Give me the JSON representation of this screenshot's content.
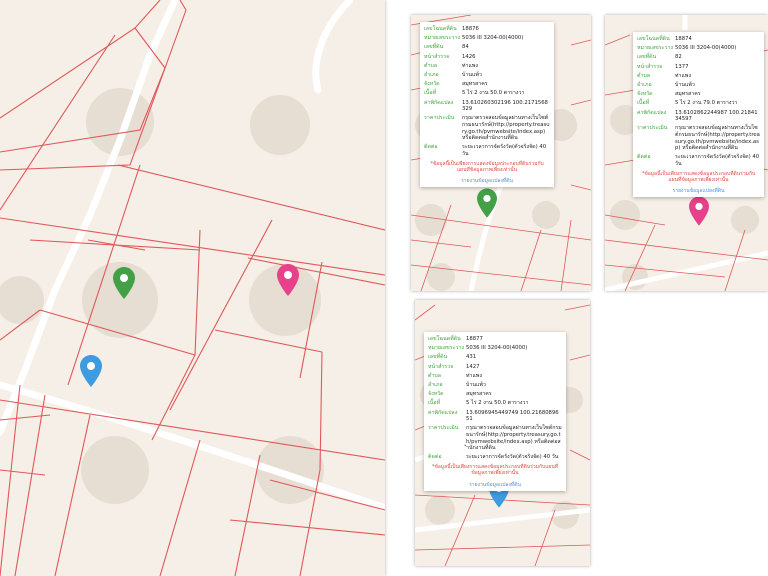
{
  "colors": {
    "map_bg": "#f6efe7",
    "parcel_line": "#e0585a",
    "road": "#ffffff",
    "pin_green": "#43a047",
    "pin_pink": "#e6418a",
    "pin_blue": "#3d9be0",
    "label_green": "#3ca53c",
    "note_red": "#e0473f",
    "link_blue": "#4a90d9"
  },
  "pins": [
    {
      "name": "green-pin",
      "color": "green"
    },
    {
      "name": "pink-pin",
      "color": "pink"
    },
    {
      "name": "blue-pin",
      "color": "blue"
    }
  ],
  "cards": [
    {
      "pin": "green",
      "rows": [
        {
          "label": "เลขโฉนดที่ดิน",
          "value": "18876"
        },
        {
          "label": "หมายเลขระวาง",
          "value": "5036 III 3204-00(4000)"
        },
        {
          "label": "เลขที่ดิน",
          "value": "84"
        },
        {
          "label": "หน้าสำรวจ",
          "value": "1426"
        },
        {
          "label": "ตำบล",
          "value": "ท่าแพง"
        },
        {
          "label": "อำเภอ",
          "value": "บ้านแพ้ว"
        },
        {
          "label": "จังหวัด",
          "value": "สมุทรสาคร"
        },
        {
          "label": "เนื้อที่",
          "value": "5 ไร่ 2 งาน 50.0 ตารางวา"
        },
        {
          "label": "ค่าพิกัดแปลง",
          "value": "13.610260302196 100.2171568329"
        },
        {
          "label": "ราคาประเมิน",
          "value": "กรุณาตรวจสอบข้อมูลผ่านทางเว็บไซต์กรมธนารักษ์(http://property.treasury.go.th/pvmwebsite/index.asp) หรือติดต่อสำนักงานที่ดิน"
        },
        {
          "label": "ติดต่อ",
          "value": "ระยะเวลาการจัดรังวัด(ตัวจริงจัด) 40 วัน"
        }
      ],
      "note": "*ข้อมูลนี้เป็นเพียงการแสดงข้อมูลประกอบที่ดินร่วมกับแผนที่ข้อมูลภาพเพียงเท่านั้น",
      "link": "รายงานข้อมูลแปลงที่ดิน"
    },
    {
      "pin": "pink",
      "rows": [
        {
          "label": "เลขโฉนดที่ดิน",
          "value": "18874"
        },
        {
          "label": "หมายเลขระวาง",
          "value": "5036 III 3204-00(4000)"
        },
        {
          "label": "เลขที่ดิน",
          "value": "82"
        },
        {
          "label": "หน้าสำรวจ",
          "value": "1377"
        },
        {
          "label": "ตำบล",
          "value": "ท่าแพง"
        },
        {
          "label": "อำเภอ",
          "value": "บ้านแพ้ว"
        },
        {
          "label": "จังหวัด",
          "value": "สมุทรสาคร"
        },
        {
          "label": "เนื้อที่",
          "value": "5 ไร่ 2 งาน 79.0 ตารางวา"
        },
        {
          "label": "ค่าพิกัดแปลง",
          "value": "13.6102862244987 100.2184134597"
        },
        {
          "label": "ราคาประเมิน",
          "value": "กรุณาตรวจสอบข้อมูลผ่านทางเว็บไซต์กรมธนารักษ์(http://property.treasury.go.th/pvmwebsite/index.asp) หรือติดต่อสำนักงานที่ดิน"
        },
        {
          "label": "ติดต่อ",
          "value": "ระยะเวลาการจัดรังวัด(ตัวจริงจัด) 40 วัน"
        }
      ],
      "note": "*ข้อมูลนี้เป็นเพียงการแสดงข้อมูลประกอบที่ดินร่วมกับแผนที่ข้อมูลภาพเพียงเท่านั้น",
      "link": "รายงานข้อมูลแปลงที่ดิน"
    },
    {
      "pin": "blue",
      "rows": [
        {
          "label": "เลขโฉนดที่ดิน",
          "value": "18877"
        },
        {
          "label": "หมายเลขระวาง",
          "value": "5036 III 3204-00(4000)"
        },
        {
          "label": "เลขที่ดิน",
          "value": "431"
        },
        {
          "label": "หน้าสำรวจ",
          "value": "1427"
        },
        {
          "label": "ตำบล",
          "value": "ท่าแพง"
        },
        {
          "label": "อำเภอ",
          "value": "บ้านแพ้ว"
        },
        {
          "label": "จังหวัด",
          "value": "สมุทรสาคร"
        },
        {
          "label": "เนื้อที่",
          "value": "5 ไร่ 2 งาน 50.0 ตารางวา"
        },
        {
          "label": "ค่าพิกัดแปลง",
          "value": "13.6096945449749 100.2168089651"
        },
        {
          "label": "ราคาประเมิน",
          "value": "กรุณาตรวจสอบข้อมูลผ่านทางเว็บไซต์กรมธนารักษ์(http://property.treasury.go.th/pvmwebsite/index.asp) หรือติดต่อสำนักงานที่ดิน"
        },
        {
          "label": "ติดต่อ",
          "value": "ระยะเวลาการจัดรังวัด(ตัวจริงจัด) 40 วัน"
        }
      ],
      "note": "*ข้อมูลนี้เป็นเพียงการแสดงข้อมูลประกอบที่ดินร่วมกับแผนที่ข้อมูลภาพเพียงเท่านั้น",
      "link": "รายงานข้อมูลแปลงที่ดิน"
    }
  ]
}
